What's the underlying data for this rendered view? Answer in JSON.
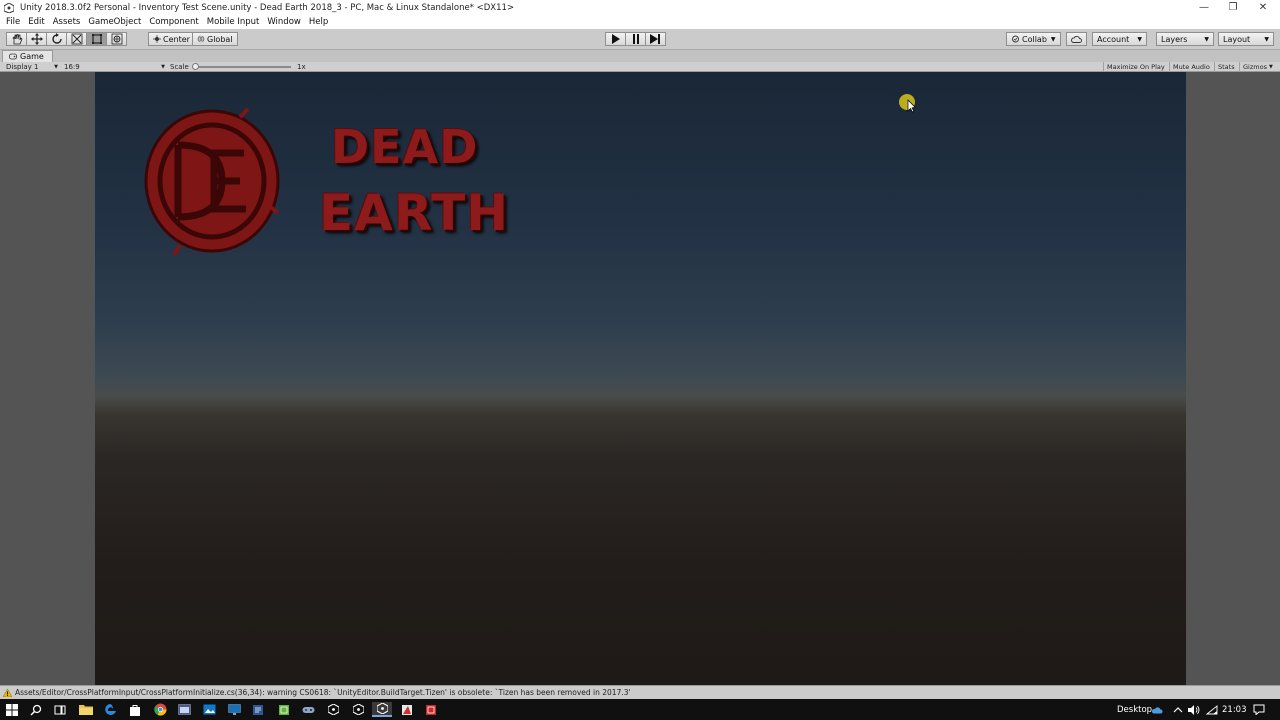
{
  "window": {
    "title": "Unity 2018.3.0f2 Personal - Inventory Test Scene.unity - Dead Earth 2018_3 - PC, Mac & Linux Standalone* <DX11>"
  },
  "menu": [
    "File",
    "Edit",
    "Assets",
    "GameObject",
    "Component",
    "Mobile Input",
    "Window",
    "Help"
  ],
  "toolbar": {
    "pivot_label": "Center",
    "space_label": "Global",
    "collab_label": "Collab",
    "account_label": "Account",
    "layers_label": "Layers",
    "layout_label": "Layout"
  },
  "game_tab": {
    "label": "Game",
    "display": "Display 1",
    "aspect": "16:9",
    "scale_label": "Scale",
    "scale_value": "1x",
    "maximize_on_play": "Maximize On Play",
    "mute_audio": "Mute Audio",
    "stats": "Stats",
    "gizmos": "Gizmos"
  },
  "game_view": {
    "logo_line1": "DEAD",
    "logo_line2": "EARTH"
  },
  "status": {
    "message": "Assets/Editor/CrossPlatformInput/CrossPlatformInitialize.cs(36,34): warning CS0618: `UnityEditor.BuildTarget.Tizen' is obsolete: `Tizen has been removed in 2017.3'"
  },
  "taskbar": {
    "desktop_label": "Desktop",
    "time": "21:03"
  },
  "colors": {
    "logo_red": "#8e1b1b",
    "toolbar_bg": "#cbcbcb"
  }
}
